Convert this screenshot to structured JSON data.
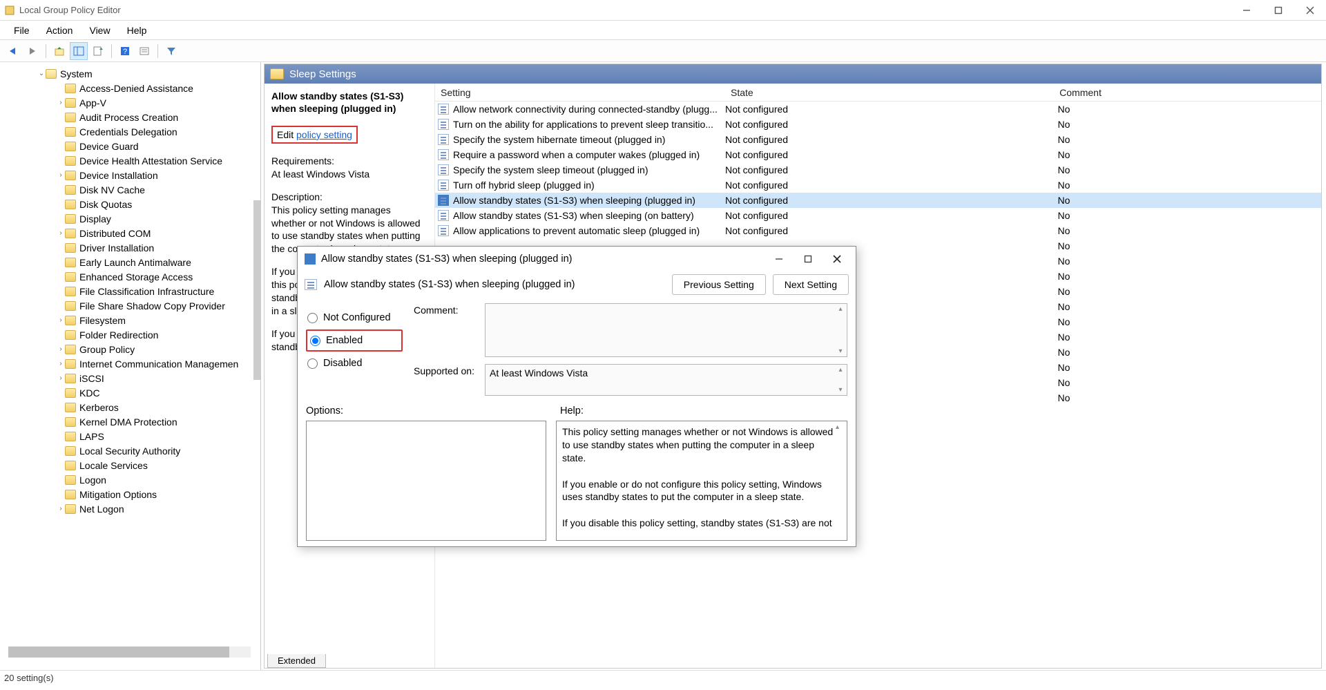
{
  "window": {
    "title": "Local Group Policy Editor"
  },
  "menu": {
    "file": "File",
    "action": "Action",
    "view": "View",
    "help": "Help"
  },
  "tree": {
    "root": "System",
    "items": [
      {
        "label": "Access-Denied Assistance",
        "indent": 2,
        "exp": ""
      },
      {
        "label": "App-V",
        "indent": 2,
        "exp": ">"
      },
      {
        "label": "Audit Process Creation",
        "indent": 2,
        "exp": ""
      },
      {
        "label": "Credentials Delegation",
        "indent": 2,
        "exp": ""
      },
      {
        "label": "Device Guard",
        "indent": 2,
        "exp": ""
      },
      {
        "label": "Device Health Attestation Service",
        "indent": 2,
        "exp": ""
      },
      {
        "label": "Device Installation",
        "indent": 2,
        "exp": ">"
      },
      {
        "label": "Disk NV Cache",
        "indent": 2,
        "exp": ""
      },
      {
        "label": "Disk Quotas",
        "indent": 2,
        "exp": ""
      },
      {
        "label": "Display",
        "indent": 2,
        "exp": ""
      },
      {
        "label": "Distributed COM",
        "indent": 2,
        "exp": ">"
      },
      {
        "label": "Driver Installation",
        "indent": 2,
        "exp": ""
      },
      {
        "label": "Early Launch Antimalware",
        "indent": 2,
        "exp": ""
      },
      {
        "label": "Enhanced Storage Access",
        "indent": 2,
        "exp": ""
      },
      {
        "label": "File Classification Infrastructure",
        "indent": 2,
        "exp": ""
      },
      {
        "label": "File Share Shadow Copy Provider",
        "indent": 2,
        "exp": ""
      },
      {
        "label": "Filesystem",
        "indent": 2,
        "exp": ">"
      },
      {
        "label": "Folder Redirection",
        "indent": 2,
        "exp": ""
      },
      {
        "label": "Group Policy",
        "indent": 2,
        "exp": ">"
      },
      {
        "label": "Internet Communication Managemen",
        "indent": 2,
        "exp": ">"
      },
      {
        "label": "iSCSI",
        "indent": 2,
        "exp": ">"
      },
      {
        "label": "KDC",
        "indent": 2,
        "exp": ""
      },
      {
        "label": "Kerberos",
        "indent": 2,
        "exp": ""
      },
      {
        "label": "Kernel DMA Protection",
        "indent": 2,
        "exp": ""
      },
      {
        "label": "LAPS",
        "indent": 2,
        "exp": ""
      },
      {
        "label": "Local Security Authority",
        "indent": 2,
        "exp": ""
      },
      {
        "label": "Locale Services",
        "indent": 2,
        "exp": ""
      },
      {
        "label": "Logon",
        "indent": 2,
        "exp": ""
      },
      {
        "label": "Mitigation Options",
        "indent": 2,
        "exp": ""
      },
      {
        "label": "Net Logon",
        "indent": 2,
        "exp": ">"
      }
    ]
  },
  "content": {
    "header": "Sleep Settings",
    "policy_title": "Allow standby states (S1-S3) when sleeping (plugged in)",
    "edit_prefix": "Edit ",
    "edit_link": "policy setting",
    "req_label": "Requirements:",
    "req_text": "At least Windows Vista",
    "desc_label": "Description:",
    "desc_p1": "This policy setting manages whether or not Windows is allowed to use standby states when putting the computer in a sleep state.",
    "desc_p2": "If you enable or do not configure this policy setting, Windows uses standby states to put the computer in a sleep state.",
    "desc_p3": "If you disable this policy setting, standby",
    "columns": {
      "setting": "Setting",
      "state": "State",
      "comment": "Comment"
    },
    "rows": [
      {
        "setting": "Allow network connectivity during connected-standby (plugg...",
        "state": "Not configured",
        "comment": "No"
      },
      {
        "setting": "Turn on the ability for applications to prevent sleep transitio...",
        "state": "Not configured",
        "comment": "No"
      },
      {
        "setting": "Specify the system hibernate timeout (plugged in)",
        "state": "Not configured",
        "comment": "No"
      },
      {
        "setting": "Require a password when a computer wakes (plugged in)",
        "state": "Not configured",
        "comment": "No"
      },
      {
        "setting": "Specify the system sleep timeout (plugged in)",
        "state": "Not configured",
        "comment": "No"
      },
      {
        "setting": "Turn off hybrid sleep (plugged in)",
        "state": "Not configured",
        "comment": "No"
      },
      {
        "setting": "Allow standby states (S1-S3) when sleeping (plugged in)",
        "state": "Not configured",
        "comment": "No",
        "selected": true
      },
      {
        "setting": "Allow standby states (S1-S3) when sleeping (on battery)",
        "state": "Not configured",
        "comment": "No"
      },
      {
        "setting": "Allow applications to prevent automatic sleep (plugged in)",
        "state": "Not configured",
        "comment": "No"
      },
      {
        "setting": "",
        "state": "",
        "comment": "No"
      },
      {
        "setting": "",
        "state": "",
        "comment": "No"
      },
      {
        "setting": "",
        "state": "",
        "comment": "No"
      },
      {
        "setting": "",
        "state": "",
        "comment": "No"
      },
      {
        "setting": "",
        "state": "",
        "comment": "No"
      },
      {
        "setting": "",
        "state": "",
        "comment": "No"
      },
      {
        "setting": "",
        "state": "",
        "comment": "No"
      },
      {
        "setting": "",
        "state": "",
        "comment": "No"
      },
      {
        "setting": "",
        "state": "",
        "comment": "No"
      },
      {
        "setting": "",
        "state": "",
        "comment": "No"
      },
      {
        "setting": "",
        "state": "",
        "comment": "No"
      }
    ],
    "tab_extended": "Extended"
  },
  "dialog": {
    "title": "Allow standby states (S1-S3) when sleeping (plugged in)",
    "subtitle": "Allow standby states (S1-S3) when sleeping (plugged in)",
    "prev": "Previous Setting",
    "next": "Next Setting",
    "not_configured": "Not Configured",
    "enabled": "Enabled",
    "disabled": "Disabled",
    "comment_label": "Comment:",
    "supported_label": "Supported on:",
    "supported_text": "At least Windows Vista",
    "options_label": "Options:",
    "help_label": "Help:",
    "help_p1": "This policy setting manages whether or not Windows is allowed to use standby states when putting the computer in a sleep state.",
    "help_p2": "If you enable or do not configure this policy setting, Windows uses standby states to put the computer in a sleep state.",
    "help_p3": "If you disable this policy setting, standby states (S1-S3) are not"
  },
  "status": "20 setting(s)"
}
